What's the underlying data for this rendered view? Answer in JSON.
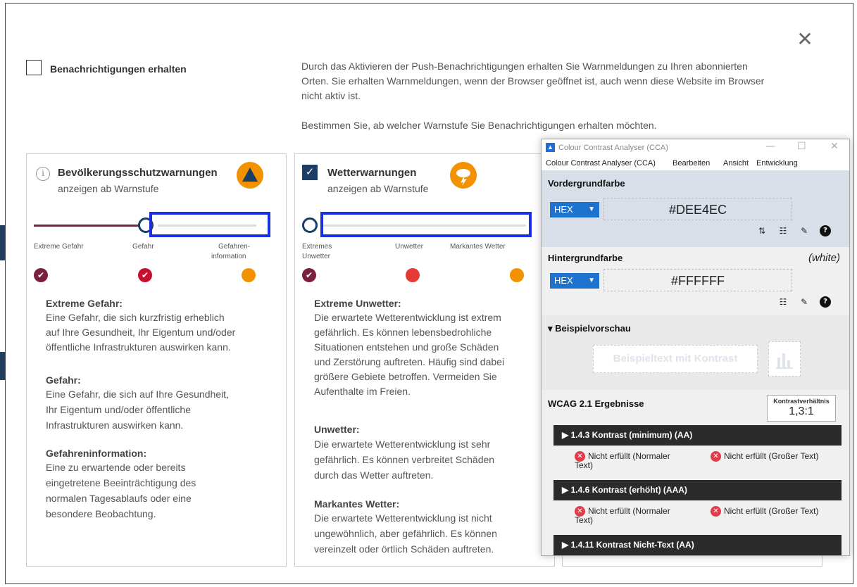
{
  "notifications": {
    "label": "Benachrichtigungen erhalten",
    "checked": false,
    "desc1": "Durch das Aktivieren der Push-Benachrichtigungen erhalten Sie Warnmeldungen zu Ihren abonnierten",
    "desc2": "Orten. Sie erhalten Warnmeldungen, wenn der Browser geöffnet ist, auch wenn diese Website im Browser",
    "desc3": "nicht aktiv ist.",
    "desc4": "Bestimmen Sie, ab welcher Warnstufe Sie Benachrichtigungen erhalten möchten."
  },
  "card1": {
    "title": "Bevölkerungsschutzwarnungen",
    "subtitle": "anzeigen ab Warnstufe",
    "levels": [
      "Extreme Gefahr",
      "Gefahr",
      "Gefahren-",
      "information"
    ],
    "selected_level": "Gefahr",
    "sections": [
      {
        "heading": "Extreme Gefahr:",
        "lines": [
          "Eine Gefahr, die sich kurzfristig erheblich",
          "auf Ihre Gesundheit, Ihr Eigentum und/oder",
          "öffentliche Infrastrukturen auswirken kann."
        ]
      },
      {
        "heading": "Gefahr:",
        "lines": [
          "Eine Gefahr, die sich auf Ihre Gesundheit,",
          "Ihr Eigentum und/oder öffentliche",
          "Infrastrukturen auswirken kann."
        ]
      },
      {
        "heading": "Gefahreninformation:",
        "lines": [
          "Eine zu erwartende oder bereits",
          "eingetretene Beeinträchtigung des",
          "normalen Tagesablaufs oder eine",
          "besondere Beobachtung."
        ]
      }
    ]
  },
  "card2": {
    "title": "Wetterwarnungen",
    "subtitle": "anzeigen ab Warnstufe",
    "checked": true,
    "levels": [
      "Extremes",
      "Unwetter",
      "Unwetter",
      "Markantes Wetter"
    ],
    "selected_level": "Extremes Unwetter",
    "sections": [
      {
        "heading": "Extreme Unwetter:",
        "lines": [
          "Die erwartete Wetterentwicklung ist extrem",
          "gefährlich. Es können lebensbedrohliche",
          "Situationen entstehen und große Schäden",
          "und Zerstörung auftreten. Häufig sind dabei",
          "größere Gebiete betroffen. Vermeiden Sie",
          "Aufenthalte im Freien."
        ]
      },
      {
        "heading": "Unwetter:",
        "lines": [
          "Die erwartete Wetterentwicklung ist sehr",
          "gefährlich. Es können verbreitet Schäden",
          "durch das Wetter auftreten."
        ]
      },
      {
        "heading": "Markantes Wetter:",
        "lines": [
          "Die erwartete Wetterentwicklung ist nicht",
          "ungewöhnlich, aber gefährlich. Es können",
          "vereinzelt oder örtlich Schäden auftreten."
        ]
      }
    ]
  },
  "colors": {
    "danger_extreme": "#7b1f3f",
    "danger": "#c8102e",
    "info": "#f39200",
    "unwetter": "#e53935",
    "navy": "#1a3e66"
  },
  "cca": {
    "title": "Colour Contrast Analyser (CCA)",
    "menu": [
      "Colour Contrast Analyser (CCA)",
      "Bearbeiten",
      "Ansicht",
      "Entwicklung"
    ],
    "foreground": {
      "label": "Vordergrundfarbe",
      "format": "HEX",
      "value": "#DEE4EC"
    },
    "background": {
      "label": "Hintergrundfarbe",
      "name": "(white)",
      "format": "HEX",
      "value": "#FFFFFF"
    },
    "preview": {
      "label": "▾ Beispielvorschau",
      "text": "Beispieltext mit Kontrast"
    },
    "results": {
      "label": "WCAG 2.1 Ergebnisse",
      "ratio_label": "Kontrastverhältnis",
      "ratio": "1,3:1",
      "criteria": [
        {
          "name": "▶  1.4.3 Kontrast (minimum) (AA)",
          "normal": "Nicht erfüllt (Normaler",
          "normal2": "Text)",
          "large": "Nicht erfüllt (Großer Text)"
        },
        {
          "name": "▶  1.4.6 Kontrast (erhöht) (AAA)",
          "normal": "Nicht erfüllt (Normaler",
          "normal2": "Text)",
          "large": "Nicht erfüllt (Großer Text)"
        },
        {
          "name": "▶  1.4.11 Kontrast Nicht-Text (AA)"
        }
      ]
    }
  }
}
